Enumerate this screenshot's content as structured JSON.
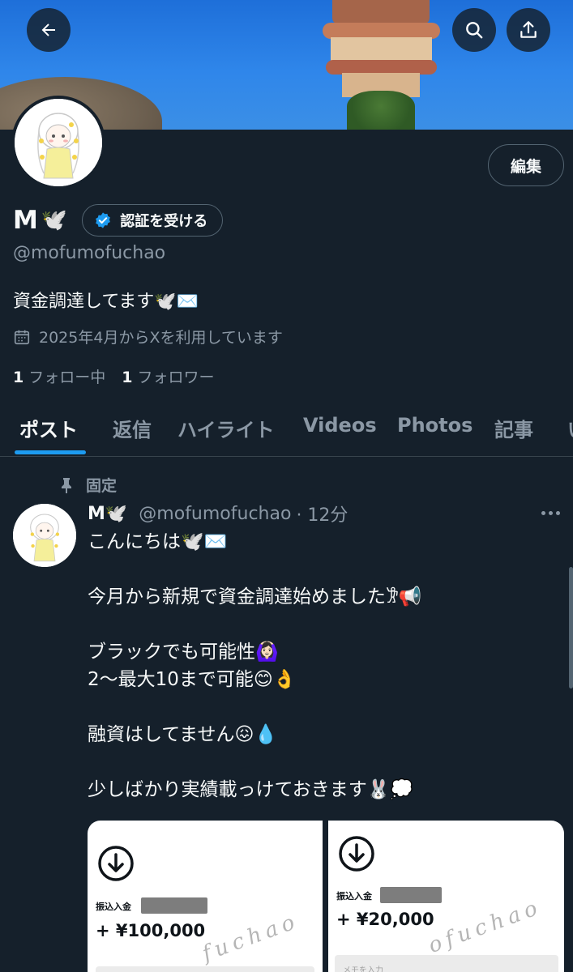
{
  "banner": {
    "alt": "castle tower banner"
  },
  "header": {
    "back_icon": "arrow-left-icon",
    "search_icon": "search-icon",
    "share_icon": "share-icon"
  },
  "profile": {
    "name": "M",
    "name_emoji": "🕊️",
    "verify_label": "認証を受ける",
    "edit_label": "編集",
    "handle": "@mofumofuchao",
    "bio": "資金調達してます🕊️✉️",
    "joined": "2025年4月からXを利用しています",
    "following_count": "1",
    "following_label": "フォロー中",
    "followers_count": "1",
    "followers_label": "フォロワー"
  },
  "tabs": [
    {
      "label": "ポスト",
      "active": true
    },
    {
      "label": "返信"
    },
    {
      "label": "ハイライト"
    },
    {
      "label": "Videos"
    },
    {
      "label": "Photos"
    },
    {
      "label": "記事"
    },
    {
      "label": "い"
    }
  ],
  "post": {
    "pinned_label": "固定",
    "author_name": "M🕊️",
    "author_handle": "@mofumofuchao",
    "time": "· 12分",
    "lines": [
      "こんにちは🕊️✉️",
      "",
      "今月から新規で資金調達始めました𐦂📢",
      "",
      "ブラックでも可能性🙆🏻‍♀️",
      "2〜最大10まで可能😊👌",
      "",
      "融資はしてません😖💧",
      "",
      "少しばかり実績載っけておきます🐰💭"
    ],
    "media": [
      {
        "label": "振込入金",
        "amount": "+ ¥100,000",
        "watermark": "fuchao"
      },
      {
        "label": "振込入金",
        "amount": "+ ¥20,000",
        "watermark": "ofuchao",
        "memo_placeholder": "メモを入力"
      }
    ]
  },
  "colors": {
    "bg": "#15202b",
    "accent": "#1d9bf0",
    "muted": "#8b98a5",
    "border": "#38444d"
  }
}
